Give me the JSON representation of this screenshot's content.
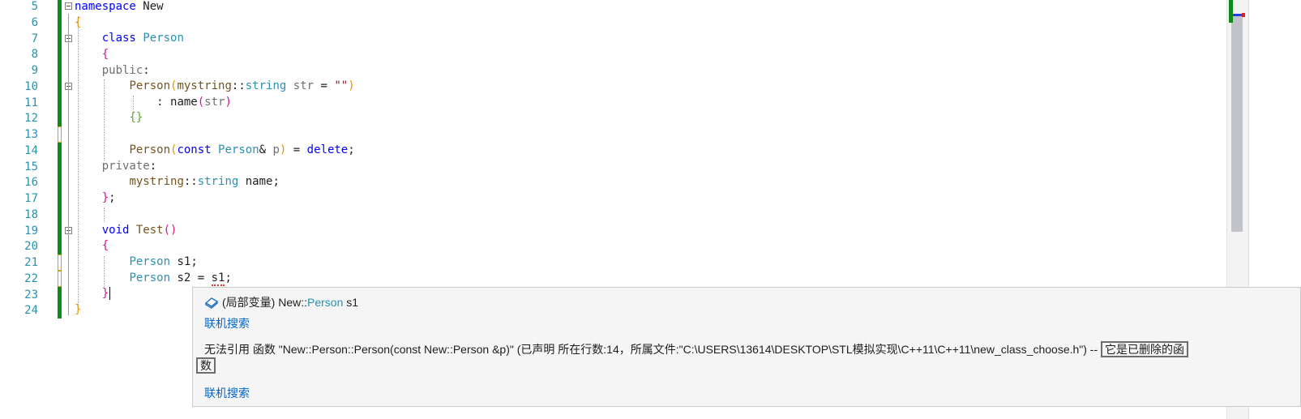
{
  "editor": {
    "lines": [
      {
        "num": "5"
      },
      {
        "num": "6"
      },
      {
        "num": "7"
      },
      {
        "num": "8"
      },
      {
        "num": "9"
      },
      {
        "num": "10"
      },
      {
        "num": "11"
      },
      {
        "num": "12"
      },
      {
        "num": "13"
      },
      {
        "num": "14"
      },
      {
        "num": "15"
      },
      {
        "num": "16"
      },
      {
        "num": "17"
      },
      {
        "num": "18"
      },
      {
        "num": "19"
      },
      {
        "num": "20"
      },
      {
        "num": "21"
      },
      {
        "num": "22"
      },
      {
        "num": "23"
      },
      {
        "num": "24"
      }
    ],
    "tokens": {
      "namespace": "namespace",
      "ns_name": "New",
      "class_kw": "class",
      "class_name": "Person",
      "public": "public",
      "private": "private",
      "mystring": "mystring",
      "scope": "::",
      "string": "string",
      "str": "str",
      "empty_str": "\"\"",
      "name": "name",
      "const": "const",
      "p": "p",
      "delete": "delete",
      "void": "void",
      "test": "Test",
      "s1": "s1",
      "s2": "s2"
    },
    "colors": {
      "change_bar_saved": "#0e8a16",
      "change_bar_unsaved": "#d9a400",
      "keyword": "#0000ff",
      "type": "#2b91af"
    }
  },
  "quickinfo": {
    "icon": "local-variable-icon",
    "header_prefix": "(局部变量) New::",
    "header_type": "Person",
    "header_suffix": " s1",
    "search_link_1": "联机搜索",
    "error_main": "无法引用 函数 \"New::Person::Person(const New::Person &p)\" (已声明 所在行数:14，所属文件:\"C:\\USERS\\13614\\DESKTOP\\STL模拟实现\\C++11\\C++11\\new_class_choose.h\") -- ",
    "error_highlight_1": "它是已删除的函",
    "error_highlight_2": "数",
    "search_link_2": "联机搜索"
  }
}
